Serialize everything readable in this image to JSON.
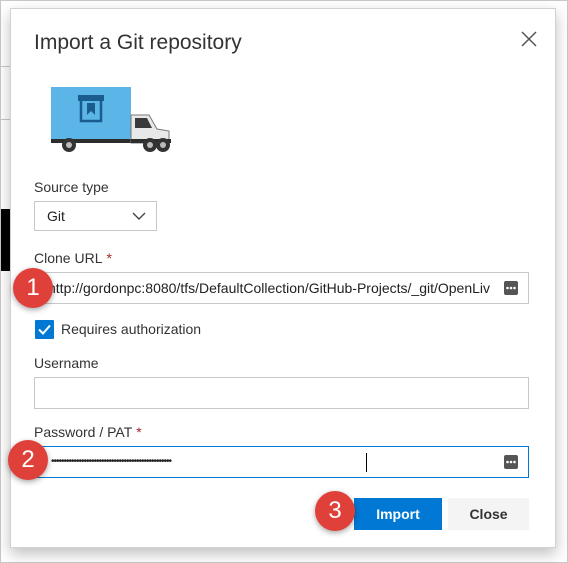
{
  "dialog": {
    "title": "Import a Git repository",
    "close_icon": "close-icon"
  },
  "source_type": {
    "label": "Source type",
    "value": "Git"
  },
  "clone_url": {
    "label": "Clone URL",
    "required_marker": "*",
    "value": "http://gordonpc:8080/tfs/DefaultCollection/GitHub-Projects/_git/OpenLiv"
  },
  "requires_authorization": {
    "label": "Requires authorization",
    "checked": true
  },
  "username": {
    "label": "Username",
    "value": ""
  },
  "password": {
    "label": "Password / PAT",
    "required_marker": "*",
    "masked_value": "••••••••••••••••••••••••••••••••••••••••••••••••"
  },
  "buttons": {
    "import_label": "Import",
    "close_label": "Close"
  },
  "step_badges": [
    "1",
    "2",
    "3"
  ],
  "colors": {
    "primary": "#0078d4",
    "badge": "#e0403a",
    "truck_body": "#5bb5e6"
  }
}
